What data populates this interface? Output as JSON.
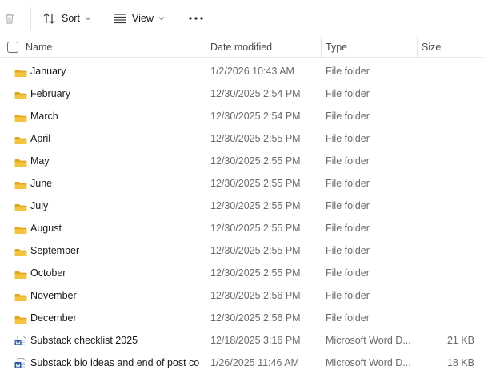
{
  "toolbar": {
    "sort_label": "Sort",
    "view_label": "View",
    "more_label": "···"
  },
  "columns": {
    "name": "Name",
    "date": "Date modified",
    "type": "Type",
    "size": "Size"
  },
  "files": [
    {
      "name": "January",
      "date": "1/2/2026 10:43 AM",
      "type": "File folder",
      "size": "",
      "icon": "folder-icon"
    },
    {
      "name": "February",
      "date": "12/30/2025 2:54 PM",
      "type": "File folder",
      "size": "",
      "icon": "folder-icon"
    },
    {
      "name": "March",
      "date": "12/30/2025 2:54 PM",
      "type": "File folder",
      "size": "",
      "icon": "folder-icon"
    },
    {
      "name": "April",
      "date": "12/30/2025 2:55 PM",
      "type": "File folder",
      "size": "",
      "icon": "folder-icon"
    },
    {
      "name": "May",
      "date": "12/30/2025 2:55 PM",
      "type": "File folder",
      "size": "",
      "icon": "folder-icon"
    },
    {
      "name": "June",
      "date": "12/30/2025 2:55 PM",
      "type": "File folder",
      "size": "",
      "icon": "folder-icon"
    },
    {
      "name": "July",
      "date": "12/30/2025 2:55 PM",
      "type": "File folder",
      "size": "",
      "icon": "folder-icon"
    },
    {
      "name": "August",
      "date": "12/30/2025 2:55 PM",
      "type": "File folder",
      "size": "",
      "icon": "folder-icon"
    },
    {
      "name": "September",
      "date": "12/30/2025 2:55 PM",
      "type": "File folder",
      "size": "",
      "icon": "folder-icon"
    },
    {
      "name": "October",
      "date": "12/30/2025 2:55 PM",
      "type": "File folder",
      "size": "",
      "icon": "folder-icon"
    },
    {
      "name": "November",
      "date": "12/30/2025 2:56 PM",
      "type": "File folder",
      "size": "",
      "icon": "folder-icon"
    },
    {
      "name": "December",
      "date": "12/30/2025 2:56 PM",
      "type": "File folder",
      "size": "",
      "icon": "folder-icon"
    },
    {
      "name": "Substack checklist 2025",
      "date": "12/18/2025 3:16 PM",
      "type": "Microsoft Word D...",
      "size": "21 KB",
      "icon": "word-document-icon"
    },
    {
      "name": "Substack bio ideas and end of post co...",
      "date": "1/26/2025 11:46 AM",
      "type": "Microsoft Word D...",
      "size": "18 KB",
      "icon": "word-document-icon"
    }
  ],
  "colors": {
    "folder": "#F4C542",
    "folder_dark": "#E0A823",
    "word_blue": "#2B579A",
    "secondary_text": "#6b6b6b"
  }
}
